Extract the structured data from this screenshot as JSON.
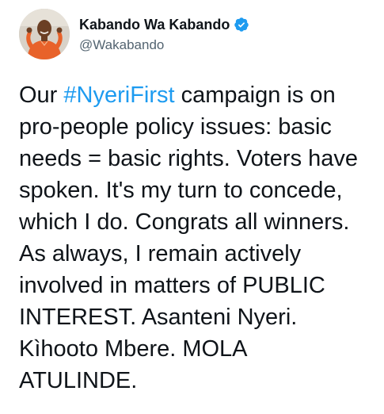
{
  "author": {
    "display_name": "Kabando Wa Kabando",
    "handle": "@Wakabando",
    "verified": true,
    "avatar_icon": "profile-photo",
    "verified_icon": "verified-badge-icon"
  },
  "tweet": {
    "lines": [
      {
        "before": "Our ",
        "hashtag": "#NyeriFirst",
        "after": " campaign is on"
      },
      {
        "text": "pro-people policy issues: basic"
      },
      {
        "text": "needs = basic rights. Voters have"
      },
      {
        "text": "spoken. It's my turn to concede,"
      },
      {
        "text": "which I do. Congrats all winners."
      },
      {
        "text": "As always, I remain actively"
      },
      {
        "text": "involved in matters of PUBLIC"
      },
      {
        "text": "INTEREST. Asanteni Nyeri."
      },
      {
        "text": "Kìhooto Mbere. MOLA"
      },
      {
        "text": "ATULINDE."
      }
    ]
  },
  "colors": {
    "text": "#0f1419",
    "secondary": "#536471",
    "accent": "#1d9bf0"
  }
}
